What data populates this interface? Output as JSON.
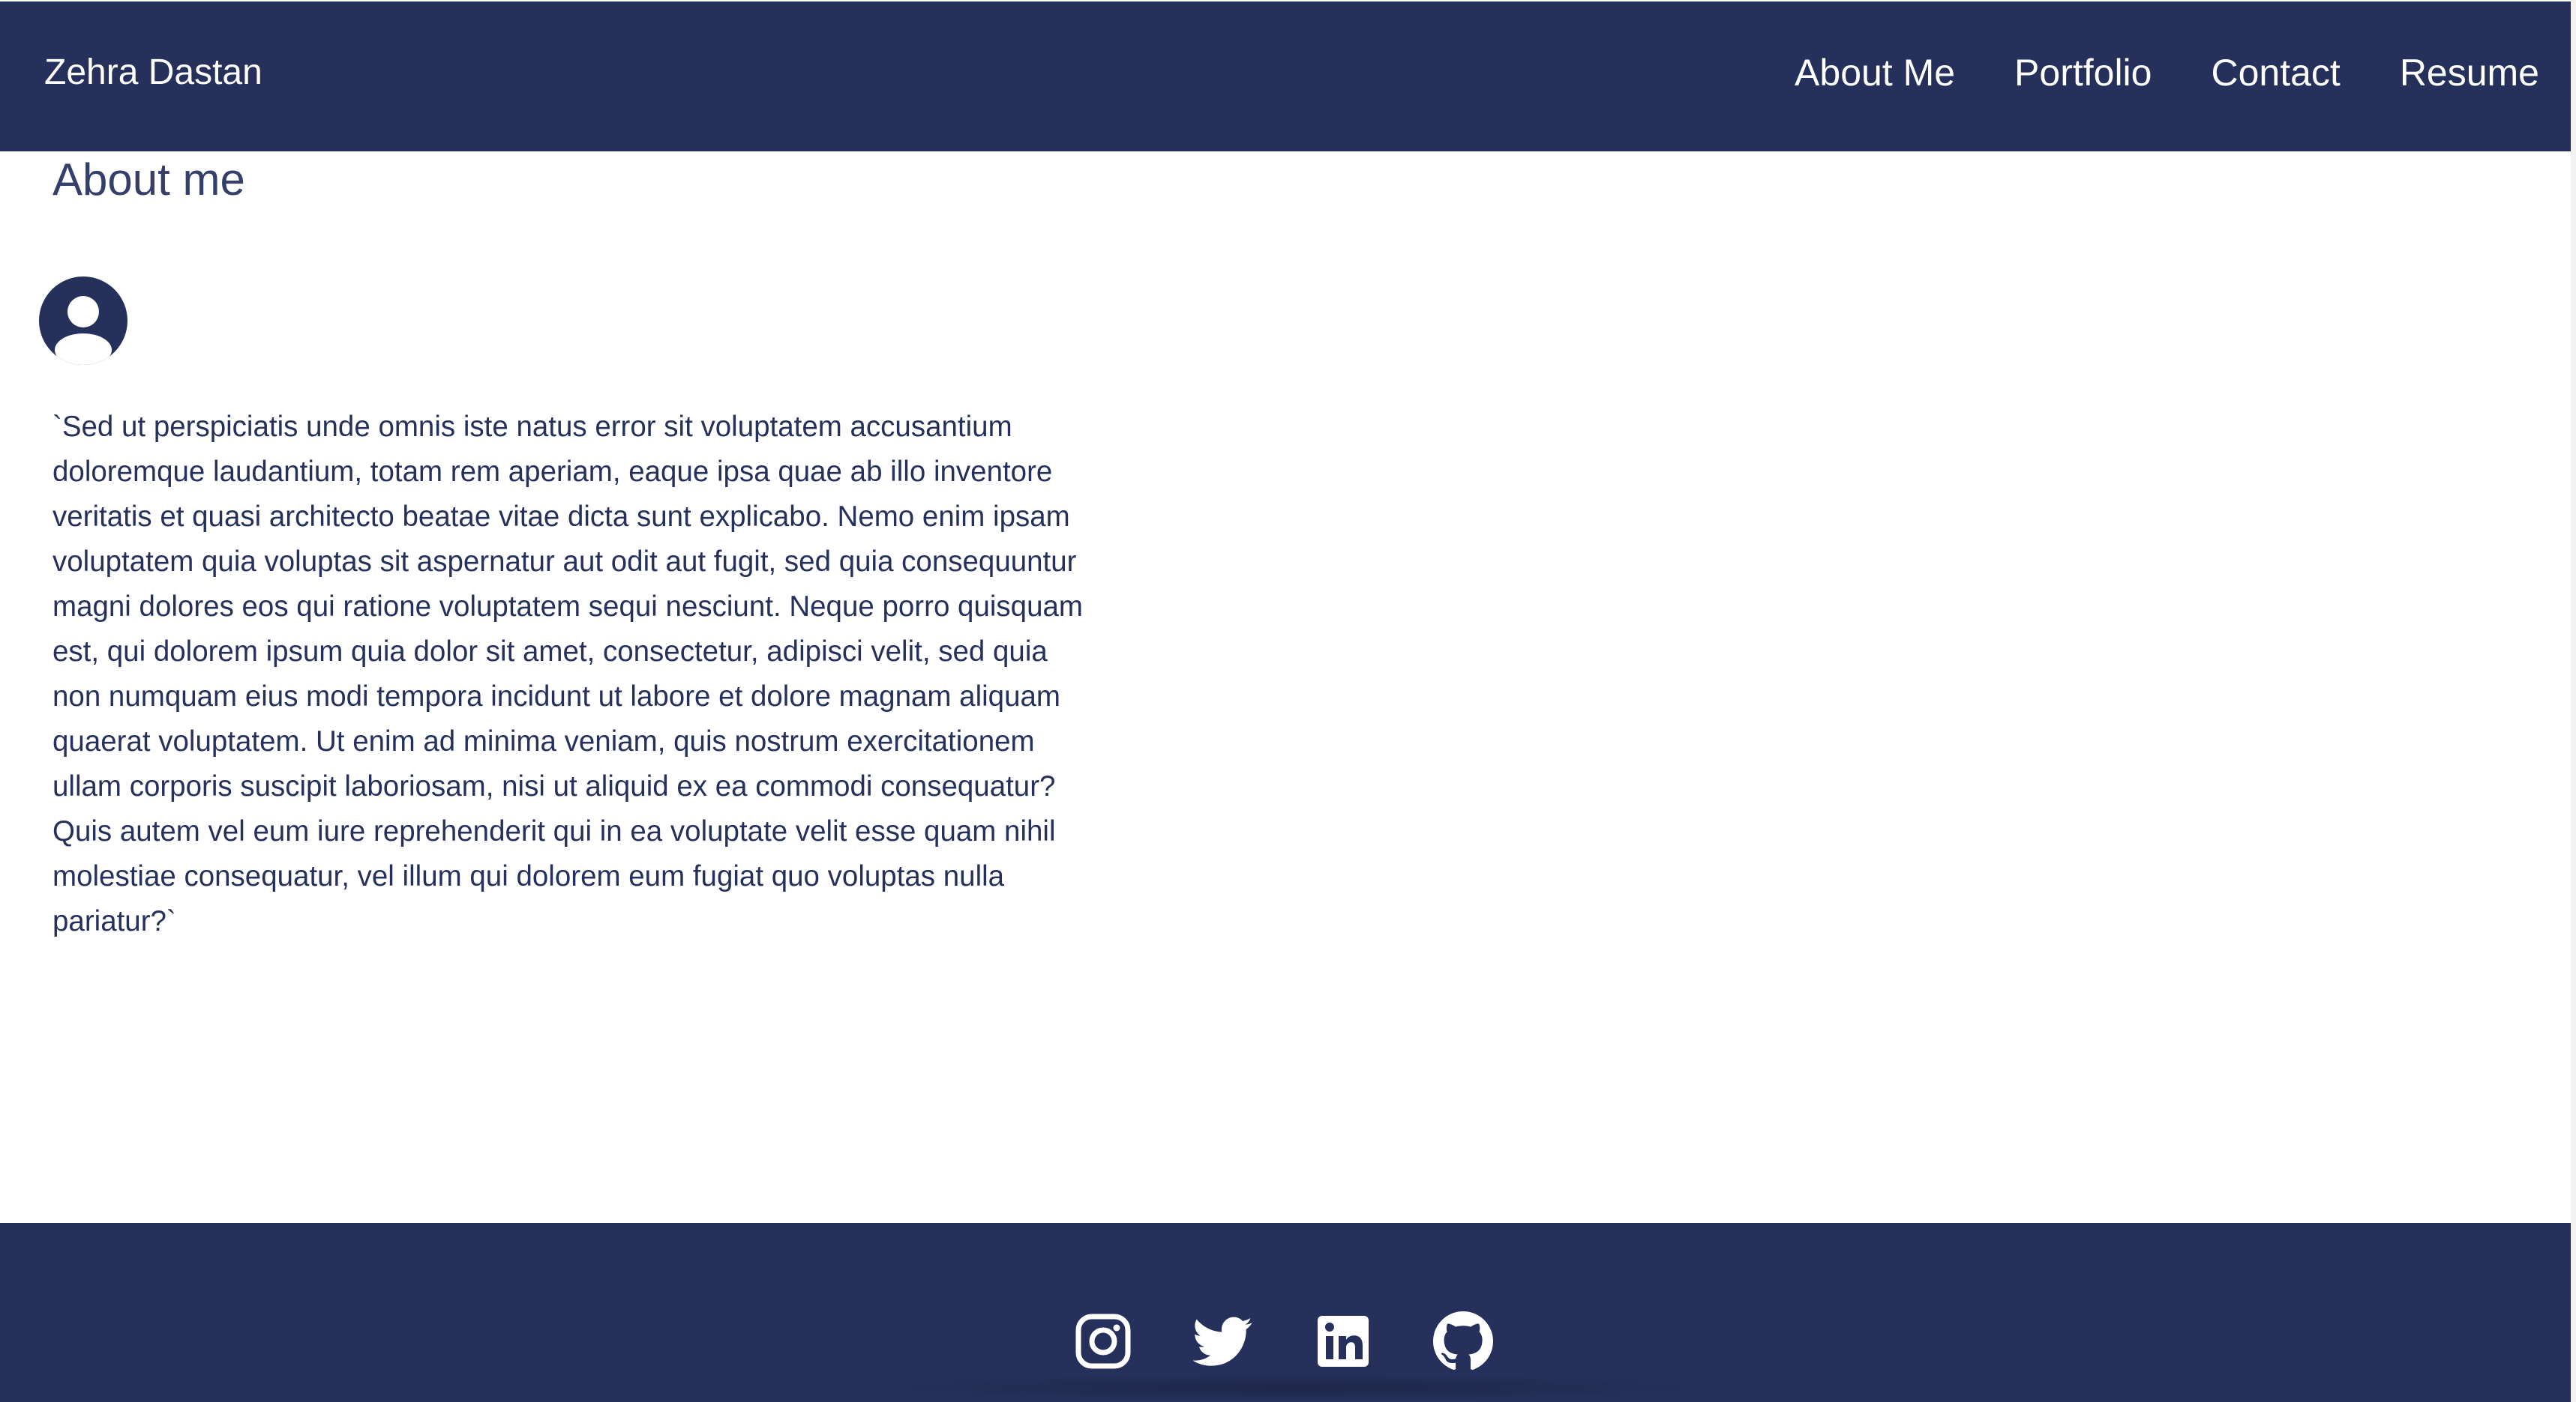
{
  "header": {
    "brand": "Zehra Dastan",
    "nav": [
      {
        "label": "About Me"
      },
      {
        "label": "Portfolio"
      },
      {
        "label": "Contact"
      },
      {
        "label": "Resume"
      }
    ]
  },
  "main": {
    "title": "About me",
    "avatar_icon": "user-circle-icon",
    "paragraph": "`Sed ut perspiciatis unde omnis iste natus error sit voluptatem accusantium doloremque laudantium, totam rem aperiam, eaque ipsa quae ab illo inventore veritatis et quasi architecto beatae vitae dicta sunt explicabo. Nemo enim ipsam voluptatem quia voluptas sit aspernatur aut odit aut fugit, sed quia consequuntur magni dolores eos qui ratione voluptatem sequi nesciunt. Neque porro quisquam est, qui dolorem ipsum quia dolor sit amet, consectetur, adipisci velit, sed quia non numquam eius modi tempora incidunt ut labore et dolore magnam aliquam quaerat voluptatem. Ut enim ad minima veniam, quis nostrum exercitationem ullam corporis suscipit laboriosam, nisi ut aliquid ex ea commodi consequatur? Quis autem vel eum iure reprehenderit qui in ea voluptate velit esse quam nihil molestiae consequatur, vel illum qui dolorem eum fugiat quo voluptas nulla pariatur?`"
  },
  "footer": {
    "social": [
      {
        "icon": "instagram-icon"
      },
      {
        "icon": "twitter-icon"
      },
      {
        "icon": "linkedin-icon"
      },
      {
        "icon": "github-icon"
      }
    ]
  },
  "colors": {
    "navy": "#25315b",
    "title": "#34406a",
    "background": "#ffffff"
  }
}
